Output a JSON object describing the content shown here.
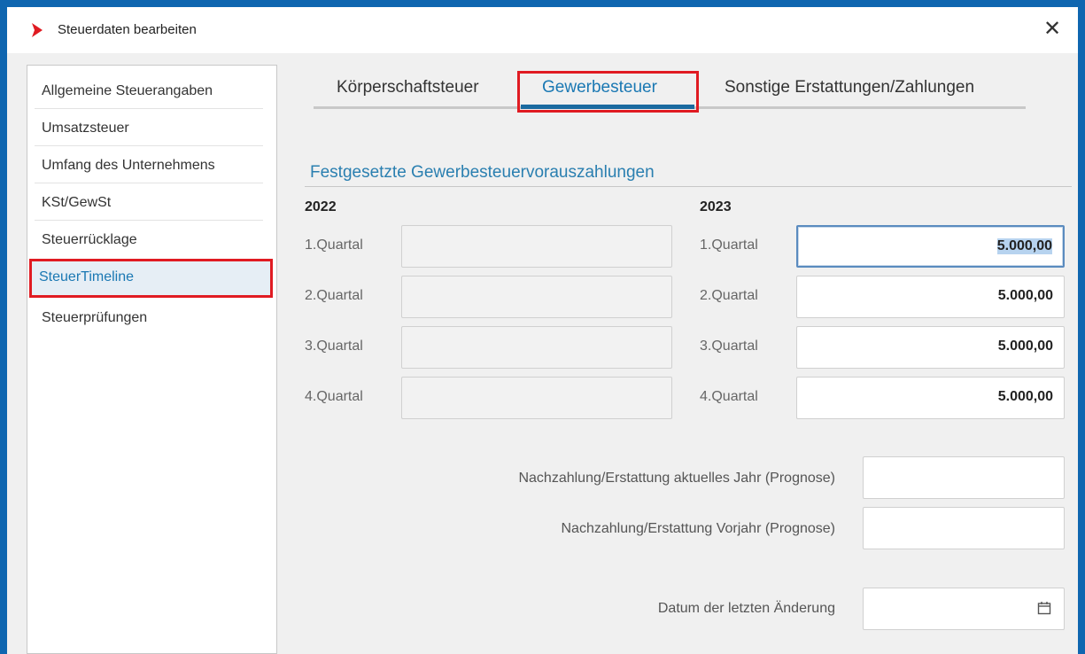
{
  "window": {
    "title": "Steuerdaten bearbeiten",
    "close_glyph": "✕",
    "title_icon": "chevron-right-icon",
    "accent": "#e01b22"
  },
  "sidebar": {
    "items": [
      {
        "label": "Allgemeine Steuerangaben",
        "active": false
      },
      {
        "label": "Umsatzsteuer",
        "active": false
      },
      {
        "label": "Umfang des Unternehmens",
        "active": false
      },
      {
        "label": "KSt/GewSt",
        "active": false
      },
      {
        "label": "Steuerrücklage",
        "active": false
      },
      {
        "label": "SteuerTimeline",
        "active": true
      },
      {
        "label": "Steuerprüfungen",
        "active": false
      }
    ]
  },
  "tabs": [
    {
      "label": "Körperschaftsteuer",
      "active": false
    },
    {
      "label": "Gewerbesteuer",
      "active": true
    },
    {
      "label": "Sonstige Erstattungen/Zahlungen",
      "active": false
    }
  ],
  "section": {
    "title": "Festgesetzte Gewerbesteuervorauszahlungen"
  },
  "year_prev": {
    "label": "2022",
    "quarters": [
      {
        "label": "1.Quartal",
        "value": ""
      },
      {
        "label": "2.Quartal",
        "value": ""
      },
      {
        "label": "3.Quartal",
        "value": ""
      },
      {
        "label": "4.Quartal",
        "value": ""
      }
    ]
  },
  "year_curr": {
    "label": "2023",
    "quarters": [
      {
        "label": "1.Quartal",
        "value": "5.000,00"
      },
      {
        "label": "2.Quartal",
        "value": "5.000,00"
      },
      {
        "label": "3.Quartal",
        "value": "5.000,00"
      },
      {
        "label": "4.Quartal",
        "value": "5.000,00"
      }
    ]
  },
  "forecast": {
    "current_label": "Nachzahlung/Erstattung aktuelles Jahr (Prognose)",
    "current_value": "",
    "previous_label": "Nachzahlung/Erstattung Vorjahr (Prognose)",
    "previous_value": "",
    "date_label": "Datum der letzten Änderung",
    "date_value": "",
    "date_icon": "calendar-icon"
  },
  "colors": {
    "frame": "#0f66b0",
    "accent_blue": "#1a78b3",
    "highlight_red": "#e01b22"
  }
}
